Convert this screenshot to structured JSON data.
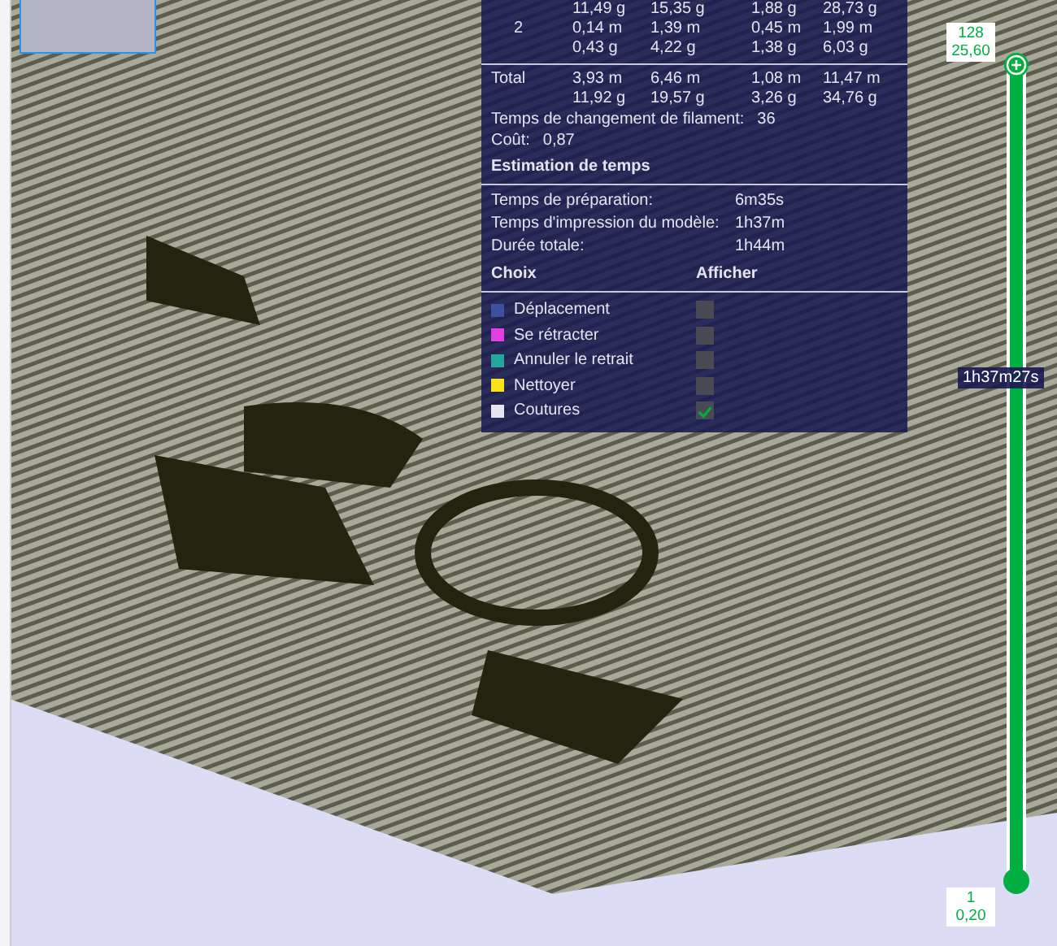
{
  "filament_table": {
    "rows": [
      {
        "values": [
          "11,49 g",
          "15,35 g",
          "1,88 g",
          "28,73 g"
        ]
      },
      {
        "label": "2",
        "values": [
          "0,14 m",
          "1,39 m",
          "0,45 m",
          "1,99 m"
        ]
      },
      {
        "values": [
          "0,43 g",
          "4,22 g",
          "1,38 g",
          "6,03 g"
        ]
      }
    ],
    "total": [
      {
        "label": "Total",
        "values": [
          "3,93 m",
          "6,46 m",
          "1,08 m",
          "11,47 m"
        ]
      },
      {
        "values": [
          "11,92 g",
          "19,57 g",
          "3,26 g",
          "34,76 g"
        ]
      }
    ]
  },
  "filament_changes": {
    "label": "Temps de changement de filament:",
    "value": "36"
  },
  "cost": {
    "label": "Coût:",
    "value": "0,87"
  },
  "time_estimate": {
    "title": "Estimation de temps",
    "rows": [
      {
        "label": "Temps de préparation:",
        "value": "6m35s"
      },
      {
        "label": "Temps d'impression du modèle:",
        "value": "1h37m"
      },
      {
        "label": "Durée totale:",
        "value": "1h44m"
      }
    ]
  },
  "legend": {
    "columns": [
      "Choix",
      "Afficher"
    ],
    "items": [
      {
        "label": "Déplacement",
        "color": "#3f4f9f",
        "checked": false
      },
      {
        "label": "Se rétracter",
        "color": "#e43fe4",
        "checked": false
      },
      {
        "label": "Annuler le retrait",
        "color": "#26a69a",
        "checked": false
      },
      {
        "label": "Nettoyer",
        "color": "#f7e51a",
        "checked": false
      },
      {
        "label": "Coutures",
        "color": "#e6e6f0",
        "checked": true
      }
    ]
  },
  "layer_slider": {
    "top_label": [
      "128",
      "25,60"
    ],
    "bottom_label": [
      "1",
      "0,20"
    ],
    "level": 1,
    "time": "1h37m27s"
  }
}
